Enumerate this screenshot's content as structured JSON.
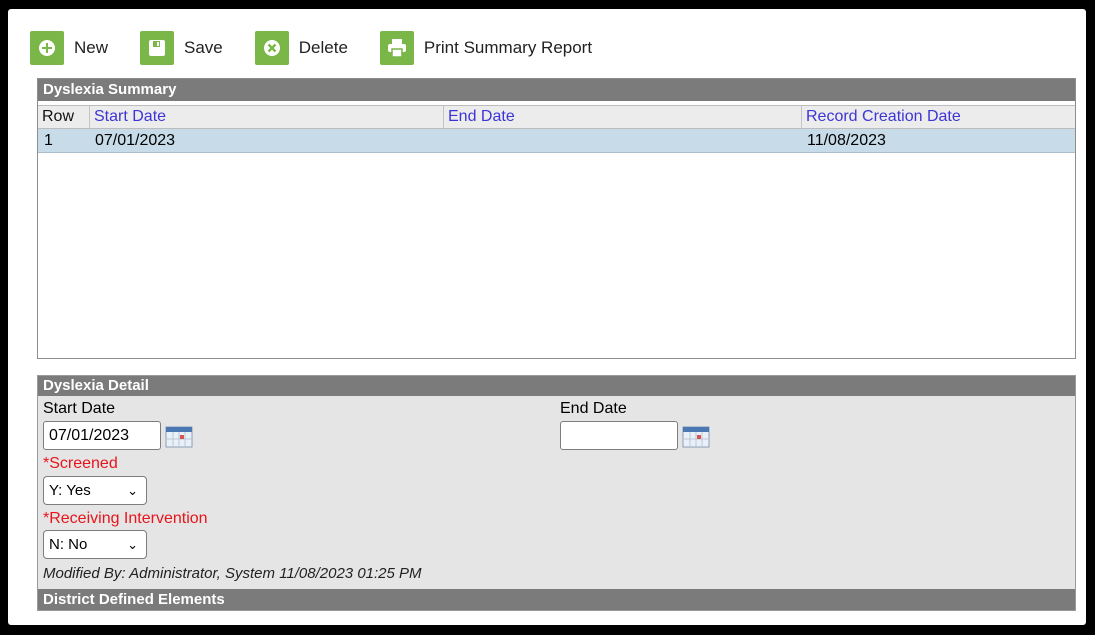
{
  "toolbar": {
    "new_label": "New",
    "save_label": "Save",
    "delete_label": "Delete",
    "print_label": "Print Summary Report"
  },
  "summary": {
    "title": "Dyslexia Summary",
    "columns": [
      "Row",
      "Start Date",
      "End Date",
      "Record Creation Date"
    ],
    "rows": [
      {
        "row": "1",
        "start_date": "07/01/2023",
        "end_date": "",
        "created": "11/08/2023"
      }
    ]
  },
  "detail": {
    "title": "Dyslexia Detail",
    "start_date_label": "Start Date",
    "start_date_value": "07/01/2023",
    "end_date_label": "End Date",
    "end_date_value": "",
    "screened_label": "*Screened",
    "screened_value": "Y: Yes",
    "intervention_label": "*Receiving Intervention",
    "intervention_value": "N: No",
    "modified": "Modified By: Administrator, System 11/08/2023 01:25 PM"
  },
  "district": {
    "title": "District Defined Elements"
  },
  "colors": {
    "accent_green": "#7ab648",
    "header_gray": "#7b7b7b",
    "selected_row": "#c7dbe8",
    "link_blue": "#3d35d6",
    "required_red": "#e8141c"
  }
}
